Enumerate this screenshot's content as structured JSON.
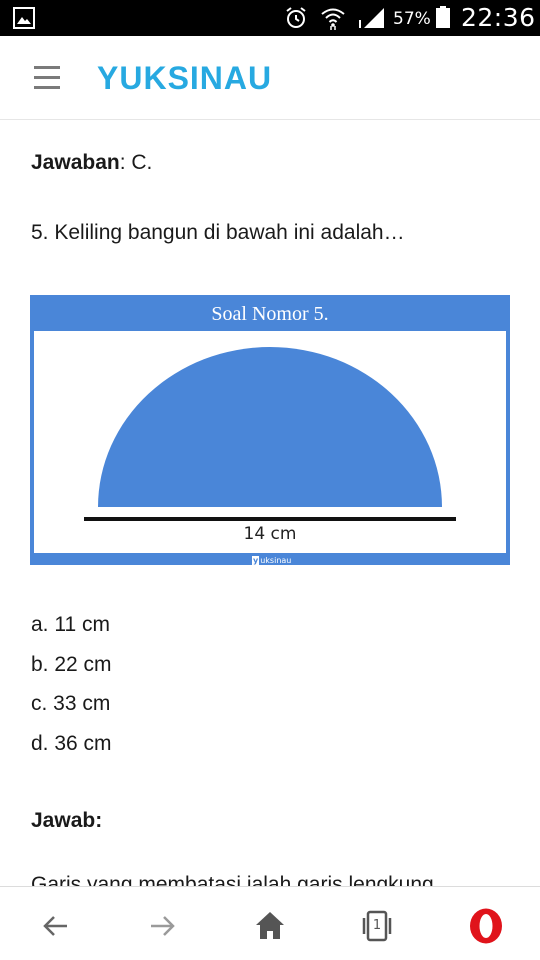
{
  "status_bar": {
    "battery_percent": "57%",
    "time": "22:36",
    "icons": [
      "gallery-icon",
      "alarm-icon",
      "wifi-icon",
      "signal-icon",
      "battery-icon"
    ]
  },
  "header": {
    "brand": "YUKSINAU",
    "brand_color": "#27a9e1",
    "menu_icon": "hamburger-menu-icon"
  },
  "content": {
    "answer_label": "Jawaban",
    "answer_value": ": C.",
    "question": "5. Keliling bangun di bawah ini adalah…",
    "figure": {
      "title": "Soal Nomor 5.",
      "measure": "14 cm",
      "watermark_badge": "y",
      "watermark_text": "uksinau",
      "accent_color": "#4a86d8"
    },
    "options": [
      "a. 11 cm",
      "b. 22 cm",
      "c. 33 cm",
      "d. 36 cm"
    ],
    "jawab_label": "Jawab:",
    "cutoff_text": "Garis yang membatasi ialah garis lengkung"
  },
  "bottom_nav": {
    "tab_count": "1",
    "icons": [
      "back-arrow-icon",
      "forward-arrow-icon",
      "home-icon",
      "tabs-icon",
      "opera-icon"
    ]
  }
}
